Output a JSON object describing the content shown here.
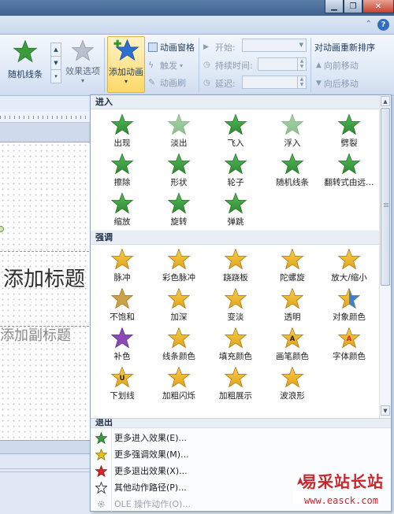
{
  "colors": {
    "star_green": "#3a9a3d",
    "star_gold": "#e3a21a",
    "star_red": "#c8262b",
    "ribbon_active": "#ffd867",
    "watermark": "#c8262b"
  },
  "window": {
    "buttons": [
      "minimize",
      "restore",
      "close"
    ],
    "help_icon": "help-icon"
  },
  "ribbon": {
    "gallery_item_label": "随机线条",
    "effect_options_label": "效果选项",
    "add_animation_label": "添加动画",
    "animation_pane_label": "动画窗格",
    "trigger_label": "触发",
    "animation_painter_label": "动画刷",
    "start_label": "开始:",
    "duration_label": "持续时间:",
    "delay_label": "延迟:",
    "reorder_title": "对动画重新排序",
    "move_earlier_label": "向前移动",
    "move_later_label": "向后移动"
  },
  "slide": {
    "title_placeholder": "添加标题",
    "subtitle_placeholder": "添加副标题"
  },
  "panel": {
    "sections": [
      {
        "title": "进入",
        "items": [
          {
            "label": "出现",
            "icon": "star-appear"
          },
          {
            "label": "淡出",
            "icon": "star-fade"
          },
          {
            "label": "飞入",
            "icon": "star-fly-in"
          },
          {
            "label": "浮入",
            "icon": "star-float-in"
          },
          {
            "label": "劈裂",
            "icon": "star-split"
          },
          {
            "label": "擦除",
            "icon": "star-wipe"
          },
          {
            "label": "形状",
            "icon": "star-shape"
          },
          {
            "label": "轮子",
            "icon": "star-wheel"
          },
          {
            "label": "随机线条",
            "icon": "star-random-bars"
          },
          {
            "label": "翻转式由远…",
            "icon": "star-grow-turn"
          },
          {
            "label": "缩放",
            "icon": "star-zoom"
          },
          {
            "label": "旋转",
            "icon": "star-swivel"
          },
          {
            "label": "弹跳",
            "icon": "star-bounce"
          }
        ]
      },
      {
        "title": "强调",
        "items": [
          {
            "label": "脉冲",
            "icon": "star-pulse"
          },
          {
            "label": "彩色脉冲",
            "icon": "star-color-pulse"
          },
          {
            "label": "跷跷板",
            "icon": "star-teeter"
          },
          {
            "label": "陀螺旋",
            "icon": "star-spin"
          },
          {
            "label": "放大/缩小",
            "icon": "star-grow-shrink"
          },
          {
            "label": "不饱和",
            "icon": "star-desaturate"
          },
          {
            "label": "加深",
            "icon": "star-darken"
          },
          {
            "label": "变淡",
            "icon": "star-lighten"
          },
          {
            "label": "透明",
            "icon": "star-transparency"
          },
          {
            "label": "对象颜色",
            "icon": "star-object-color"
          },
          {
            "label": "补色",
            "icon": "star-complementary-color"
          },
          {
            "label": "线条颜色",
            "icon": "star-line-color"
          },
          {
            "label": "填充颜色",
            "icon": "star-fill-color"
          },
          {
            "label": "画笔颜色",
            "icon": "star-brush-color"
          },
          {
            "label": "字体颜色",
            "icon": "star-font-color"
          },
          {
            "label": "下划线",
            "icon": "star-underline"
          },
          {
            "label": "加粗闪烁",
            "icon": "star-bold-flash"
          },
          {
            "label": "加粗展示",
            "icon": "star-bold-reveal"
          },
          {
            "label": "波浪形",
            "icon": "star-wave"
          }
        ]
      }
    ],
    "exit_title": "退出",
    "menu": [
      {
        "label": "更多进入效果(E)...",
        "icon": "star-green-icon",
        "enabled": true
      },
      {
        "label": "更多强调效果(M)...",
        "icon": "star-gold-icon",
        "enabled": true
      },
      {
        "label": "更多退出效果(X)...",
        "icon": "star-red-icon",
        "enabled": true
      },
      {
        "label": "其他动作路径(P)...",
        "icon": "star-outline-icon",
        "enabled": true
      },
      {
        "label": "OLE 操作动作(O)...",
        "icon": "gear-icon",
        "enabled": false
      }
    ]
  },
  "watermark": {
    "title": "易采站长站",
    "url": "www.easck.com"
  }
}
